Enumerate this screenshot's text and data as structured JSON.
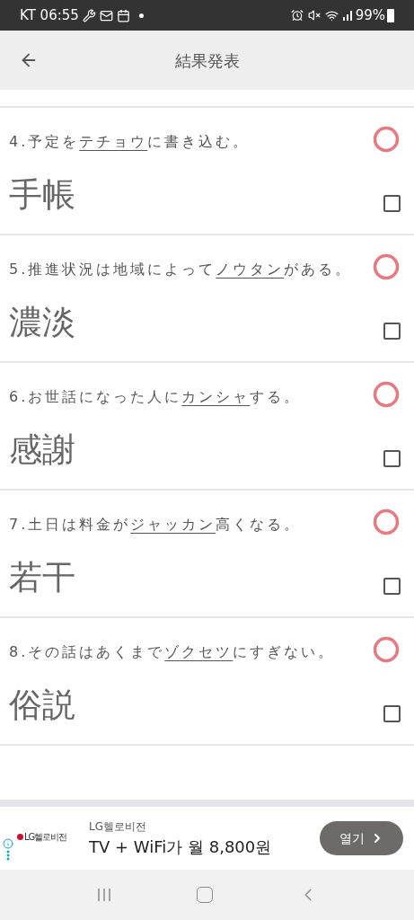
{
  "status_bar": {
    "carrier_time": "KT 06:55",
    "battery": "99%"
  },
  "app_bar": {
    "title": "結果発表"
  },
  "questions": [
    {
      "before": "4.予定を",
      "underlined": "テチョウ",
      "after": "に書き込む。",
      "answer": "手帳",
      "correct": true,
      "checked": false
    },
    {
      "before": "5.推進状況は地域によって",
      "underlined": "ノウタン",
      "after": "がある。",
      "answer": "濃淡",
      "correct": true,
      "checked": false
    },
    {
      "before": "6.お世話になった人に",
      "underlined": "カンシャ",
      "after": "する。",
      "answer": "感謝",
      "correct": true,
      "checked": false
    },
    {
      "before": "7.土日は料金が",
      "underlined": "ジャッカン",
      "after": "高くなる。",
      "answer": "若干",
      "correct": true,
      "checked": false
    },
    {
      "before": "8.その話はあくまで",
      "underlined": "ゾクセツ",
      "after": "にすぎない。",
      "answer": "俗説",
      "correct": true,
      "checked": false
    }
  ],
  "ad": {
    "brand": "LG헬로비전",
    "logo_text": "LG헬로비전",
    "headline": "TV + WiFi가 월 8,800원",
    "button": "열기"
  }
}
